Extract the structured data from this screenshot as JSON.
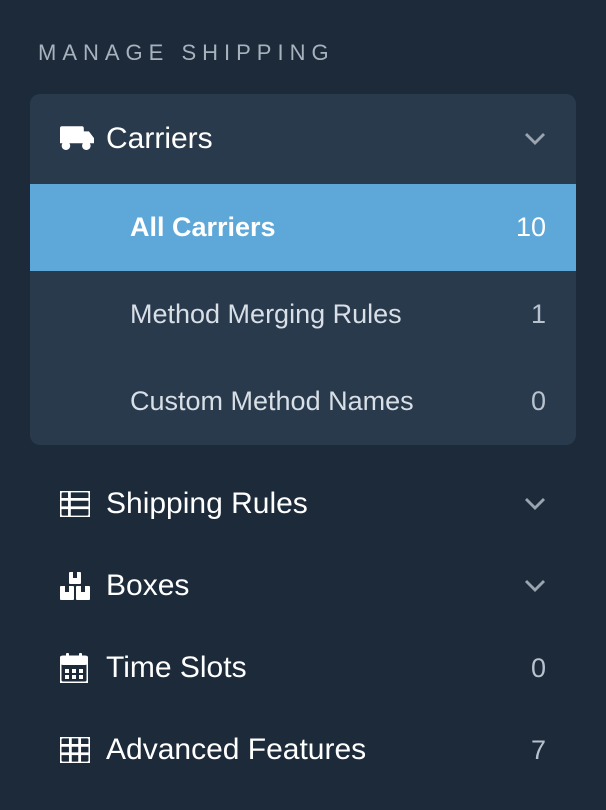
{
  "sectionTitle": "MANAGE SHIPPING",
  "menu": {
    "carriers": {
      "label": "Carriers",
      "children": {
        "all": {
          "label": "All Carriers",
          "count": "10"
        },
        "merging": {
          "label": "Method Merging Rules",
          "count": "1"
        },
        "custom": {
          "label": "Custom Method Names",
          "count": "0"
        }
      }
    },
    "shippingRules": {
      "label": "Shipping Rules"
    },
    "boxes": {
      "label": "Boxes"
    },
    "timeSlots": {
      "label": "Time Slots",
      "count": "0"
    },
    "advancedFeatures": {
      "label": "Advanced Features",
      "count": "7"
    }
  }
}
